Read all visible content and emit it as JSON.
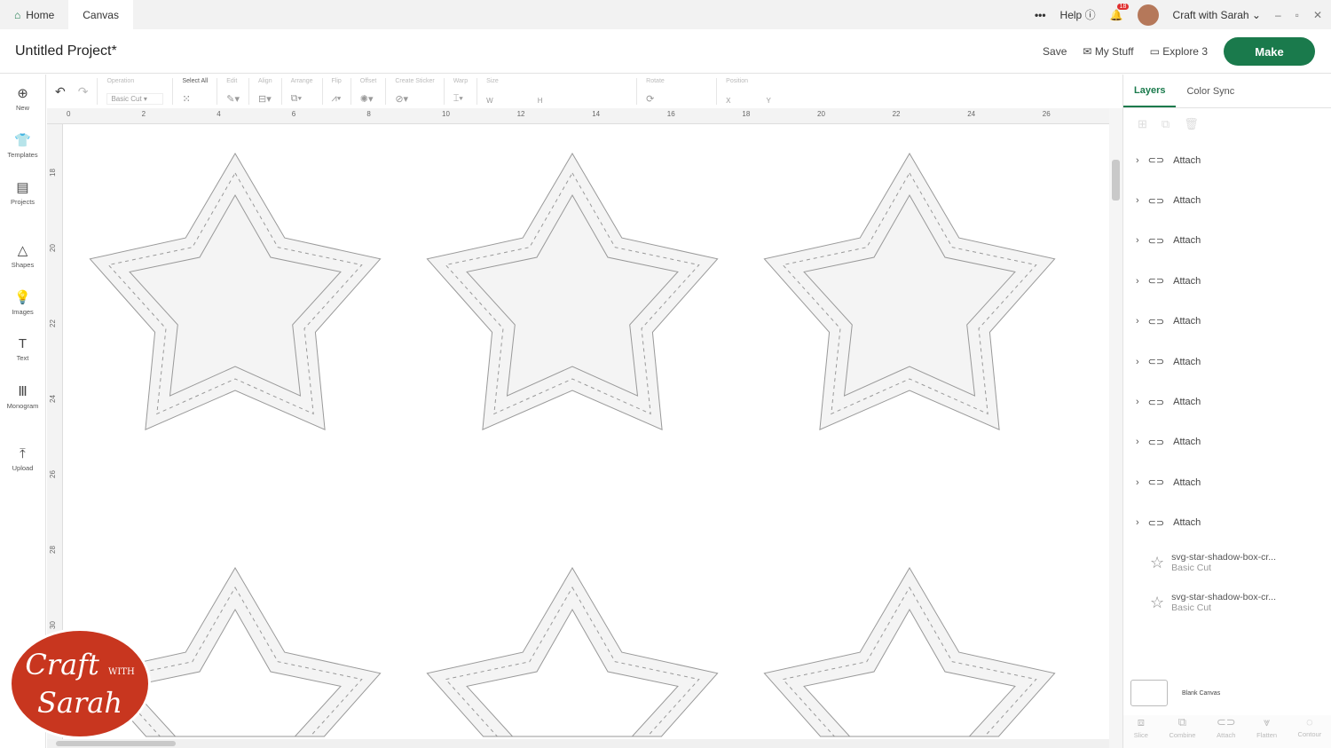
{
  "topbar": {
    "tabs": [
      "Home",
      "Canvas"
    ],
    "more": "•••",
    "help": "Help",
    "notifications": "18",
    "user": "Craft with Sarah"
  },
  "project": {
    "title": "Untitled Project*",
    "save": "Save",
    "my_stuff": "My Stuff",
    "machine": "Explore 3",
    "make": "Make"
  },
  "toolbar": {
    "operation_label": "Operation",
    "operation_value": "Basic Cut",
    "select_all": "Select All",
    "edit": "Edit",
    "align": "Align",
    "arrange": "Arrange",
    "flip": "Flip",
    "offset": "Offset",
    "create_sticker": "Create Sticker",
    "warp": "Warp",
    "size": "Size",
    "w": "W",
    "h": "H",
    "rotate": "Rotate",
    "position": "Position",
    "x": "X",
    "y": "Y"
  },
  "sidebar": [
    {
      "label": "New",
      "icon": "⊕"
    },
    {
      "label": "Templates",
      "icon": "👕"
    },
    {
      "label": "Projects",
      "icon": "▤"
    },
    {
      "label": "Shapes",
      "icon": "△"
    },
    {
      "label": "Images",
      "icon": "💡"
    },
    {
      "label": "Text",
      "icon": "T"
    },
    {
      "label": "Monogram",
      "icon": "Ⅲ"
    },
    {
      "label": "Upload",
      "icon": "⤒"
    }
  ],
  "ruler": {
    "top": [
      "0",
      "2",
      "4",
      "6",
      "8",
      "10",
      "12",
      "14",
      "16",
      "18",
      "20",
      "22",
      "24",
      "26"
    ],
    "left": [
      "18",
      "20",
      "22",
      "24",
      "26",
      "28",
      "30"
    ]
  },
  "panel": {
    "tabs": [
      "Layers",
      "Color Sync"
    ],
    "layers": [
      "Attach",
      "Attach",
      "Attach",
      "Attach",
      "Attach",
      "Attach",
      "Attach",
      "Attach",
      "Attach",
      "Attach"
    ],
    "files": [
      {
        "name": "svg-star-shadow-box-cr...",
        "op": "Basic Cut"
      },
      {
        "name": "svg-star-shadow-box-cr...",
        "op": "Basic Cut"
      }
    ],
    "blank": "Blank Canvas",
    "tools": [
      "Slice",
      "Combine",
      "Attach",
      "Flatten",
      "Contour"
    ]
  },
  "logo": {
    "line1": "Craft",
    "with": "WITH",
    "line2": "Sarah"
  },
  "colors": {
    "accent": "#1a7a4c",
    "logo": "#c8361f"
  }
}
